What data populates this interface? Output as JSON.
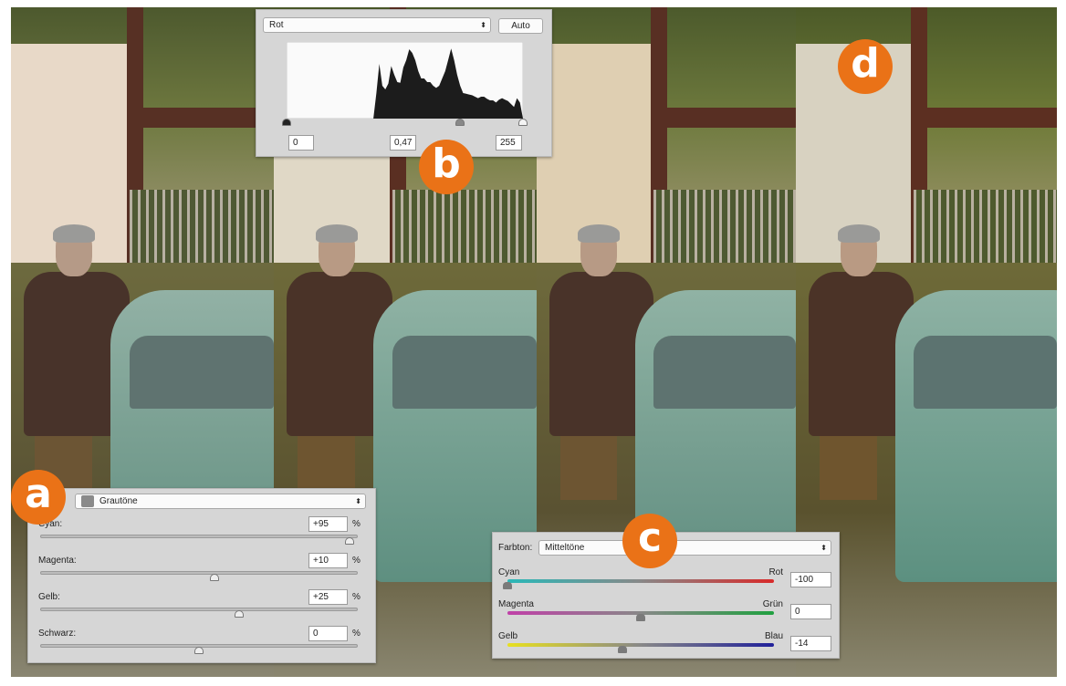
{
  "badges": {
    "a": "a",
    "b": "b",
    "c": "c",
    "d": "d"
  },
  "levels_panel": {
    "channel": "Rot",
    "auto_label": "Auto",
    "input_black": "0",
    "input_gamma": "0,47",
    "input_white": "255",
    "slider_positions": {
      "black": 0,
      "gamma": 187,
      "white": 255
    },
    "histogram": [
      0,
      0,
      0,
      0,
      0,
      0,
      0,
      0,
      0,
      0,
      0,
      0,
      0,
      0,
      0,
      0,
      0,
      0,
      0,
      0,
      0,
      0,
      0,
      0,
      0,
      0,
      0,
      0,
      0,
      0,
      35,
      75,
      45,
      40,
      48,
      72,
      60,
      50,
      49,
      70,
      80,
      95,
      90,
      80,
      65,
      55,
      55,
      50,
      50,
      45,
      42,
      45,
      55,
      65,
      80,
      96,
      80,
      60,
      45,
      35,
      34,
      33,
      32,
      30,
      28,
      30,
      30,
      27,
      25,
      25,
      22,
      26,
      28,
      26,
      24,
      20,
      16,
      28,
      22,
      0
    ]
  },
  "selective_color_panel": {
    "colors_value": "Grautöne",
    "swatch_color": "#8a8a8a",
    "rows": [
      {
        "label": "Cyan:",
        "value": "+95",
        "unit": "%",
        "slider": 95
      },
      {
        "label": "Magenta:",
        "value": "+10",
        "unit": "%",
        "slider": 10
      },
      {
        "label": "Gelb:",
        "value": "+25",
        "unit": "%",
        "slider": 25
      },
      {
        "label": "Schwarz:",
        "value": "0",
        "unit": "%",
        "slider": 0
      }
    ]
  },
  "color_balance_panel": {
    "tone_label": "Farbton:",
    "tone_value": "Mitteltöne",
    "rows": [
      {
        "left": "Cyan",
        "right": "Rot",
        "value": "-100",
        "slider": -100,
        "from": "#2ab8b8",
        "to": "#d82a2a"
      },
      {
        "left": "Magenta",
        "right": "Grün",
        "value": "0",
        "slider": 0,
        "from": "#c040a8",
        "to": "#20a040"
      },
      {
        "left": "Gelb",
        "right": "Blau",
        "value": "-14",
        "slider": -14,
        "from": "#e8e020",
        "to": "#20209a"
      }
    ]
  },
  "accent_color": "#ea7217"
}
